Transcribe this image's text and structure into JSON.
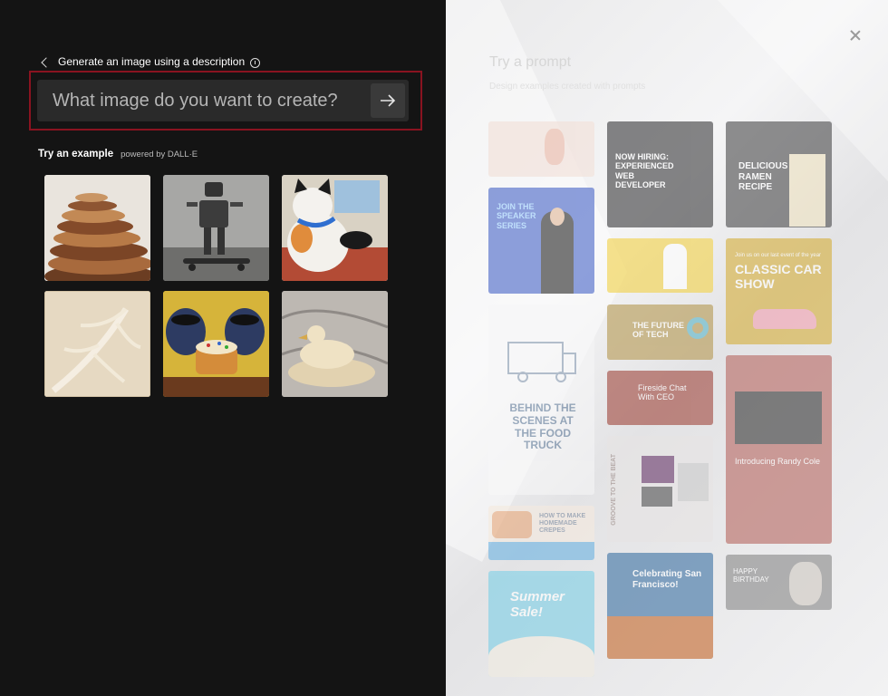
{
  "header": {
    "back_label": "Generate an image using a description"
  },
  "prompt": {
    "placeholder": "What image do you want to create?",
    "value": ""
  },
  "examples": {
    "title": "Try an example",
    "powered_by": "powered by DALL·E",
    "items": [
      {
        "name": "wooden-spiral-architecture"
      },
      {
        "name": "robot-on-skateboard"
      },
      {
        "name": "cat-playing-video-game"
      },
      {
        "name": "palm-leaf-texture"
      },
      {
        "name": "raccoons-with-cake"
      },
      {
        "name": "marble-duck-sculpture"
      }
    ]
  },
  "panel": {
    "title": "Try a prompt",
    "subtitle": "Design examples created with prompts",
    "templates": {
      "hiring": "NOW HIRING: EXPERIENCED WEB DEVELOPER",
      "ramen": "DELICIOUS RAMEN RECIPE",
      "speaker": "JOIN THE SPEAKER SERIES",
      "car_small": "Join us on our last event of the year",
      "car": "CLASSIC CAR SHOW",
      "tech": "THE FUTURE OF TECH",
      "fireside": "Fireside Chat With CEO",
      "truck": "BEHIND THE SCENES AT THE FOOD TRUCK",
      "groove": "GROOVE TO THE BEAT",
      "randy": "Introducing Randy Cole",
      "crepes": "HOW TO MAKE HOMEMADE CREPES",
      "summer": "Summer Sale!",
      "sf": "Celebrating San Francisco!",
      "birthday": "HAPPY BIRTHDAY"
    }
  },
  "colors": {
    "highlight_border": "#8a1320",
    "left_bg": "#141414",
    "input_bg": "#2a2a2a"
  }
}
